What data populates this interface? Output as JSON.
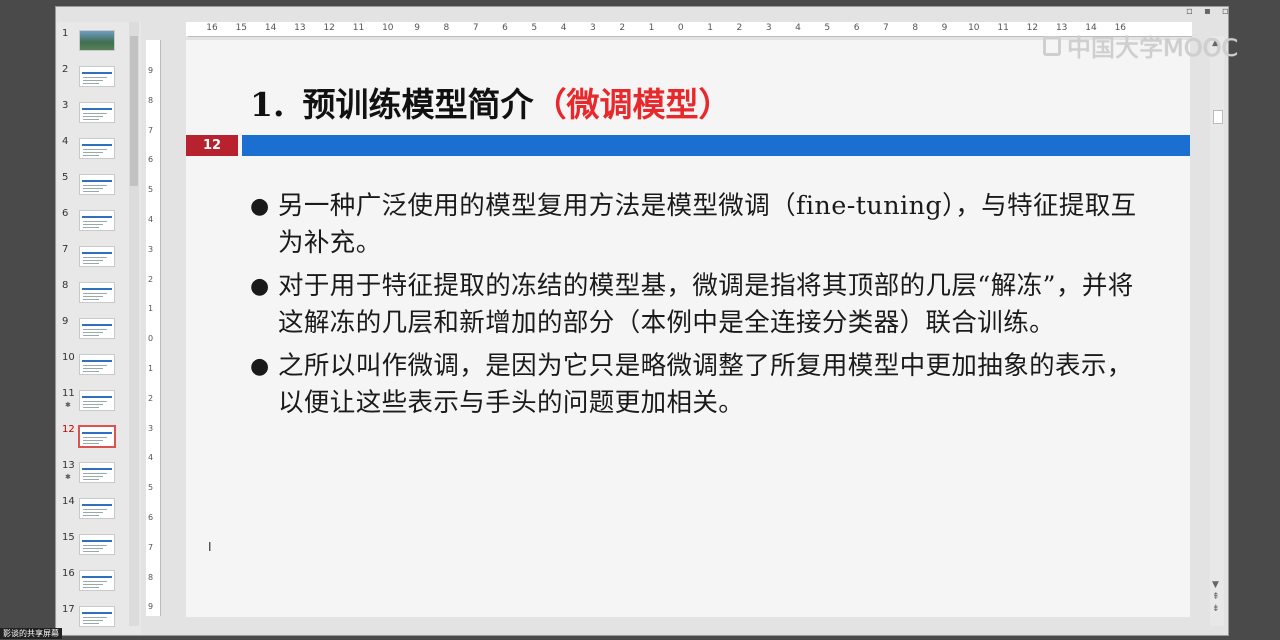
{
  "thumbnails": [
    {
      "num": "1",
      "star": ""
    },
    {
      "num": "2",
      "star": ""
    },
    {
      "num": "3",
      "star": ""
    },
    {
      "num": "4",
      "star": ""
    },
    {
      "num": "5",
      "star": ""
    },
    {
      "num": "6",
      "star": ""
    },
    {
      "num": "7",
      "star": ""
    },
    {
      "num": "8",
      "star": ""
    },
    {
      "num": "9",
      "star": ""
    },
    {
      "num": "10",
      "star": ""
    },
    {
      "num": "11",
      "star": "✱"
    },
    {
      "num": "12",
      "star": ""
    },
    {
      "num": "13",
      "star": "✱"
    },
    {
      "num": "14",
      "star": ""
    },
    {
      "num": "15",
      "star": ""
    },
    {
      "num": "16",
      "star": ""
    },
    {
      "num": "17",
      "star": ""
    }
  ],
  "active_slide": "12",
  "hruler_labels": [
    "16",
    "15",
    "14",
    "13",
    "12",
    "11",
    "10",
    "9",
    "8",
    "7",
    "6",
    "5",
    "4",
    "3",
    "2",
    "1",
    "0",
    "1",
    "2",
    "3",
    "4",
    "5",
    "6",
    "7",
    "8",
    "9",
    "10",
    "11",
    "12",
    "13",
    "14",
    "16"
  ],
  "vruler_labels": [
    "9",
    "8",
    "7",
    "6",
    "5",
    "4",
    "3",
    "2",
    "1",
    "0",
    "1",
    "2",
    "3",
    "4",
    "5",
    "6",
    "7",
    "8",
    "9"
  ],
  "slide": {
    "title_num": "1.",
    "title_main": "预训练模型简介",
    "title_accent": "（微调模型）",
    "badge": "12",
    "bullets": [
      "另一种广泛使用的模型复用方法是模型微调（fine-tuning），与特征提取互为补充。",
      "对于用于特征提取的冻结的模型基，微调是指将其顶部的几层“解冻”，并将这解冻的几层和新增加的部分（本例中是全连接分类器）联合训练。",
      "之所以叫作微调，是因为它只是略微调整了所复用模型中更加抽象的表示，以便让这些表示与手头的问题更加相关。"
    ],
    "bullet_symbol": "●"
  },
  "watermark": "中国大学MOOC",
  "window_controls": "▫ ▪ ▫",
  "cursor_glyph": "I",
  "share_label": "影谈的共享屏幕",
  "colors": {
    "title_accent": "#e8282b",
    "badge": "#b8212e",
    "band": "#1a6fd1"
  }
}
